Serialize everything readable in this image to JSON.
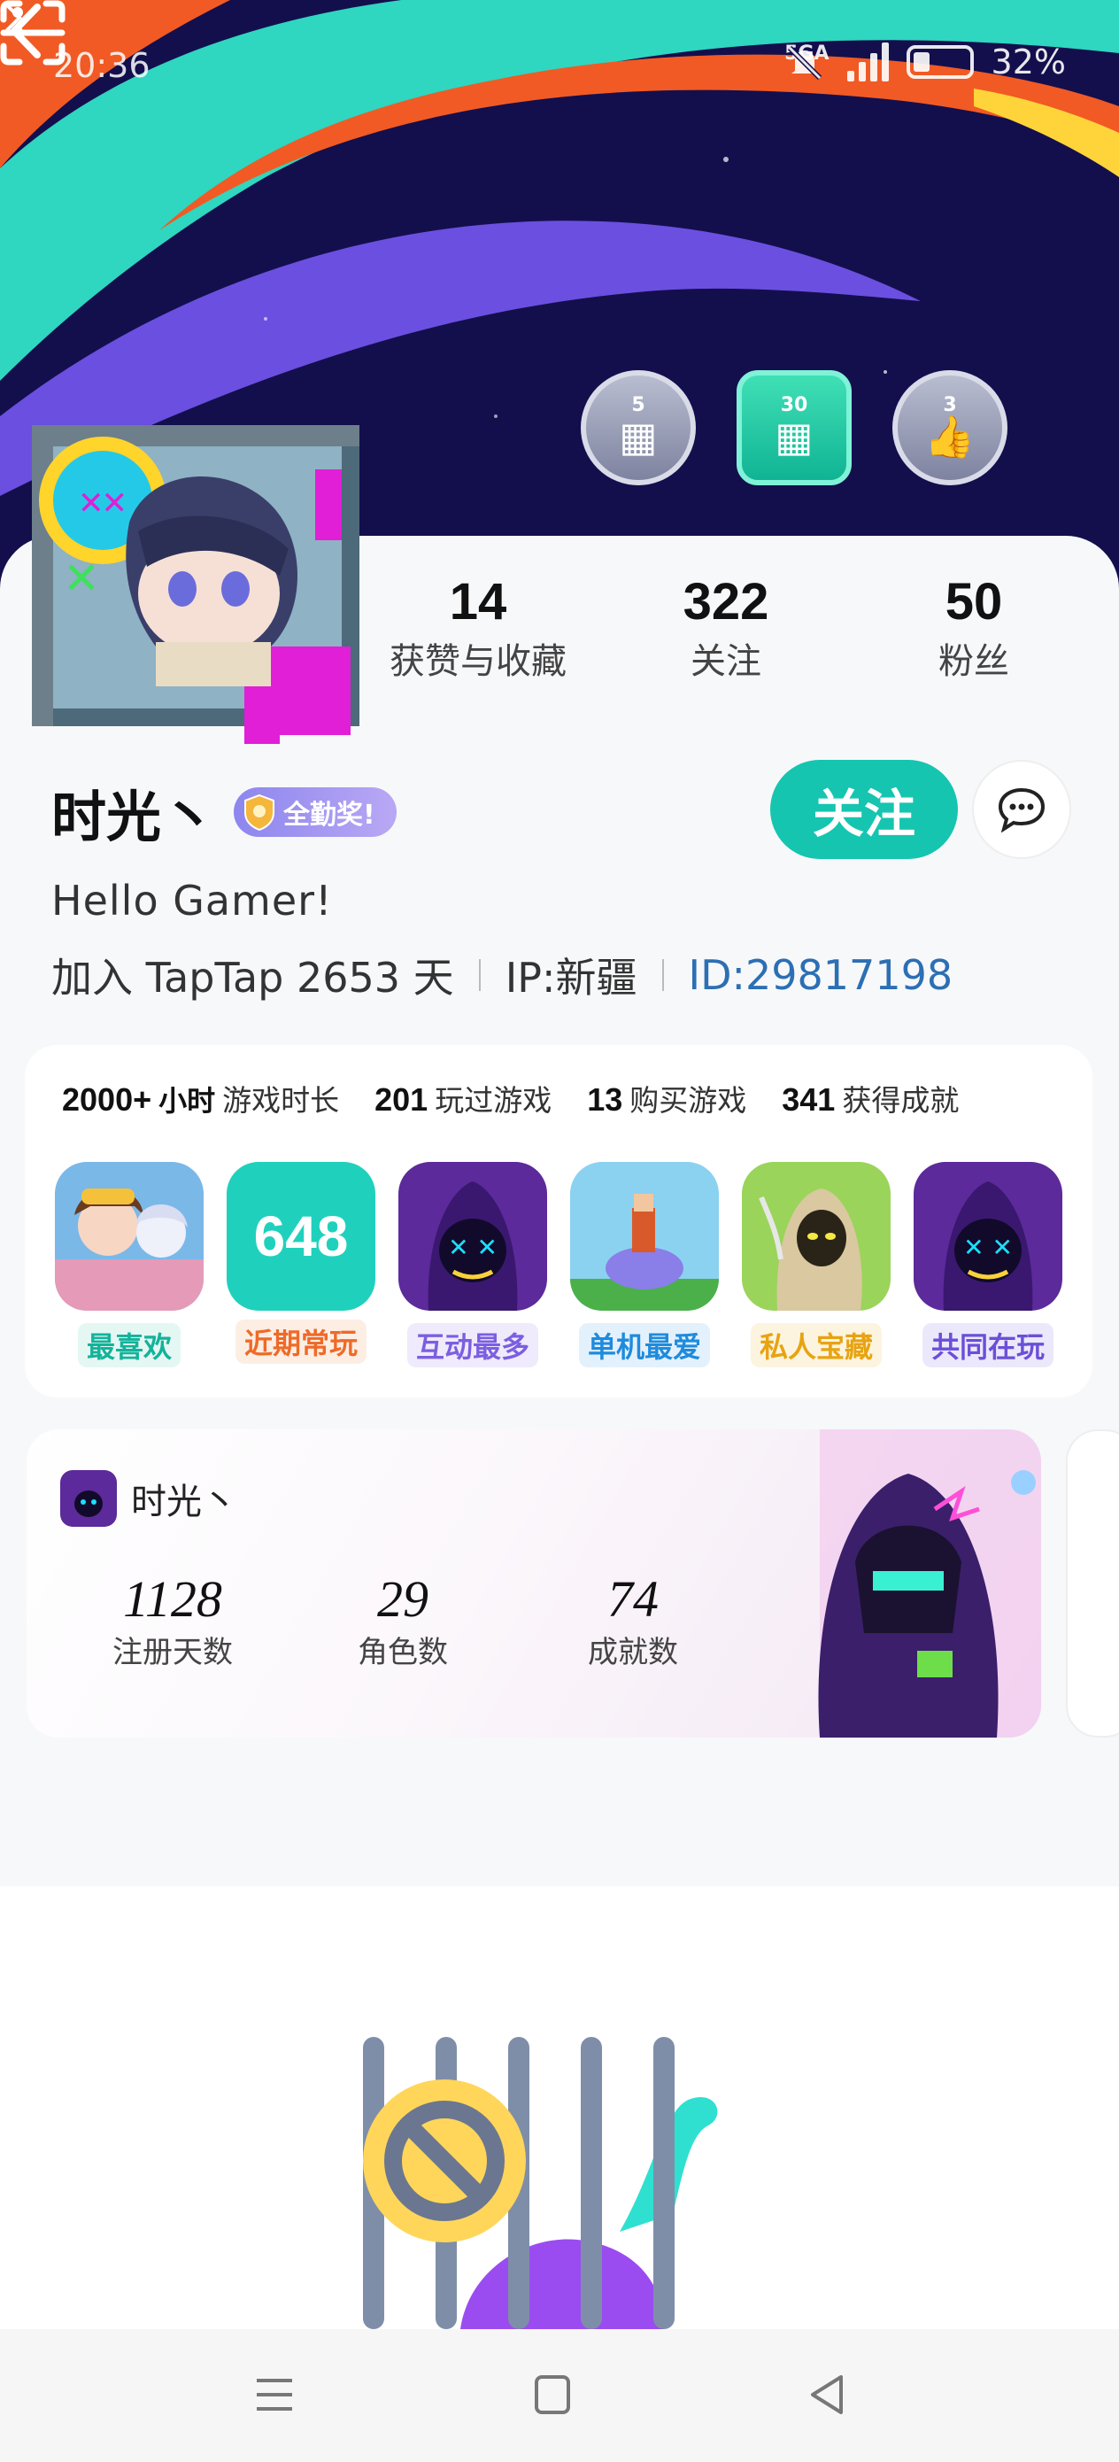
{
  "status": {
    "time": "20:36",
    "network": "5GA",
    "battery": "32%",
    "battery_level": 0.32
  },
  "badges": [
    {
      "number": "5",
      "caption": "",
      "icon": "gamepad-calendar-icon",
      "tone": "grey"
    },
    {
      "number": "30",
      "caption": "",
      "icon": "gamepad-calendar-icon",
      "tone": "green"
    },
    {
      "number": "3",
      "caption": "",
      "icon": "thumbs-up-icon",
      "tone": "grey"
    }
  ],
  "stats": [
    {
      "value": "14",
      "label": "获赞与收藏"
    },
    {
      "value": "322",
      "label": "关注"
    },
    {
      "value": "50",
      "label": "粉丝"
    }
  ],
  "user": {
    "name": "时光丶",
    "award": "全勤奖!",
    "follow_label": "关注",
    "bio": "Hello Gamer!",
    "joined": "加入 TapTap 2653 天",
    "ip": "IP:新疆",
    "id": "ID:29817198"
  },
  "game_stats": [
    {
      "value": "2000+",
      "unit": "小时",
      "label": "游戏时长"
    },
    {
      "value": "201",
      "unit": "",
      "label": "玩过游戏"
    },
    {
      "value": "13",
      "unit": "",
      "label": "购买游戏"
    },
    {
      "value": "341",
      "unit": "",
      "label": "获得成就"
    }
  ],
  "games": [
    {
      "tag": "最喜欢",
      "tag_color": "#13b39a",
      "tag_bg": "#e4f7f3",
      "icon_text": ""
    },
    {
      "tag": "近期常玩",
      "tag_color": "#ef6a28",
      "tag_bg": "#fdeee4",
      "icon_text": "648"
    },
    {
      "tag": "互动最多",
      "tag_color": "#7b5fe0",
      "tag_bg": "#efeafc",
      "icon_text": ""
    },
    {
      "tag": "单机最爱",
      "tag_color": "#1f8bdc",
      "tag_bg": "#e3f1fc",
      "icon_text": ""
    },
    {
      "tag": "私人宝藏",
      "tag_color": "#e8a312",
      "tag_bg": "#fcf4df",
      "icon_text": ""
    },
    {
      "tag": "共同在玩",
      "tag_color": "#6b4fd8",
      "tag_bg": "#ece8fb",
      "icon_text": ""
    }
  ],
  "linked_game": {
    "name": "时光丶",
    "stats": [
      {
        "value": "1128",
        "label": "注册天数"
      },
      {
        "value": "29",
        "label": "角色数"
      },
      {
        "value": "74",
        "label": "成就数"
      }
    ]
  },
  "colors": {
    "accent": "#15c5b0",
    "id_link": "#2c6fb4",
    "banner_bg": "#120f4a"
  }
}
